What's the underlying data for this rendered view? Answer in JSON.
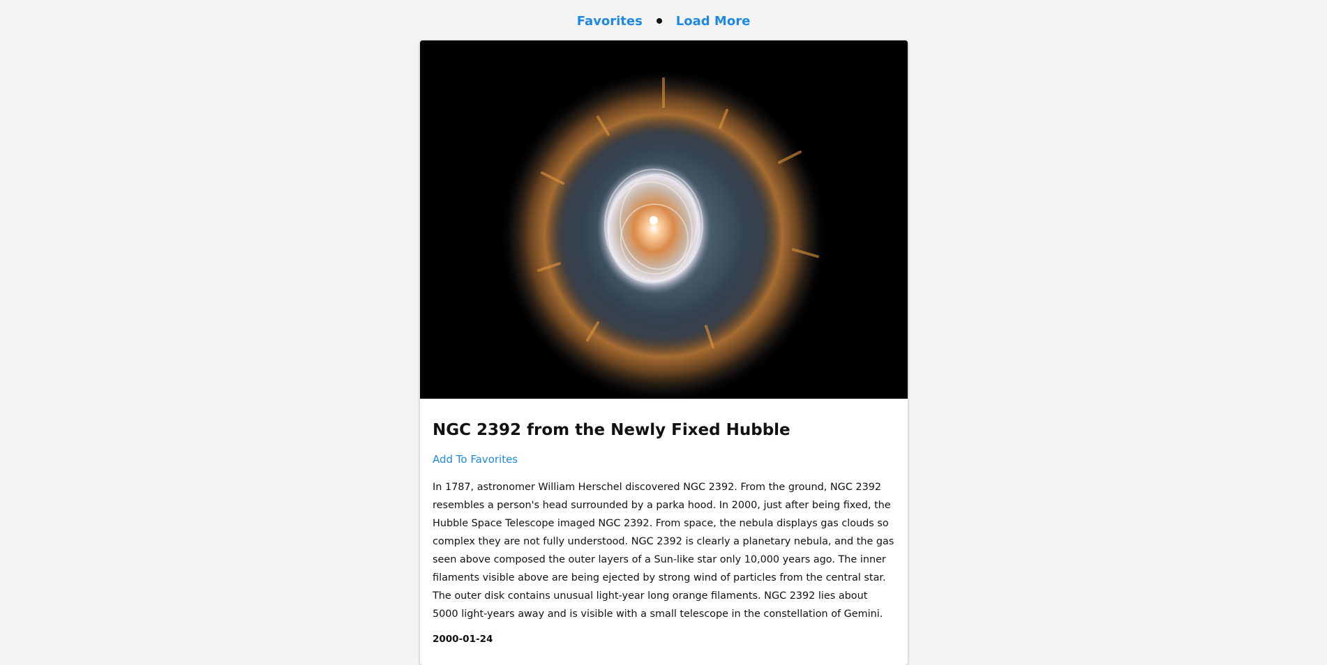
{
  "nav": {
    "favorites_label": "Favorites",
    "load_more_label": "Load More",
    "link_color": "#1e88e5"
  },
  "apod": {
    "image_alt": "NGC 2392 planetary nebula",
    "title": "NGC 2392 from the Newly Fixed Hubble",
    "add_favorites_label": "Add To Favorites",
    "explanation": "In 1787, astronomer William Herschel discovered NGC 2392. From the ground, NGC 2392 resembles a person's head surrounded by a parka hood. In 2000, just after being fixed, the Hubble Space Telescope imaged NGC 2392. From space, the nebula displays gas clouds so complex they are not fully understood. NGC 2392 is clearly a planetary nebula, and the gas seen above composed the outer layers of a Sun-like star only 10,000 years ago. The inner filaments visible above are being ejected by strong wind of particles from the central star. The outer disk contains unusual light-year long orange filaments. NGC 2392 lies about 5000 light-years away and is visible with a small telescope in the constellation of Gemini.",
    "date": "2000-01-24"
  }
}
